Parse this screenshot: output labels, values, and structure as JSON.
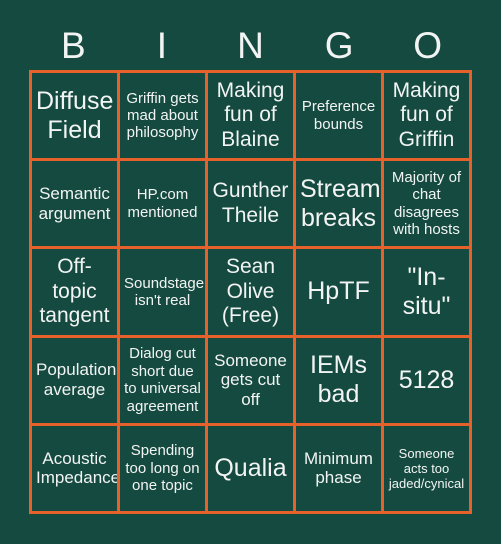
{
  "card": {
    "title": "BINGO",
    "header_letters": [
      "B",
      "I",
      "N",
      "G",
      "O"
    ],
    "colors": {
      "background": "#154a40",
      "border": "#e6622a",
      "text": "#f2f4f3"
    },
    "rows": [
      [
        {
          "text": "Diffuse Field",
          "size": "xl"
        },
        {
          "text": "Griffin gets mad about philosophy",
          "size": "sm"
        },
        {
          "text": "Making fun of Blaine",
          "size": "lg"
        },
        {
          "text": "Preference bounds",
          "size": "sm"
        },
        {
          "text": "Making fun of Griffin",
          "size": "lg"
        }
      ],
      [
        {
          "text": "Semantic argument",
          "size": "md"
        },
        {
          "text": "HP.com mentioned",
          "size": "sm"
        },
        {
          "text": "Gunther Theile",
          "size": "lg"
        },
        {
          "text": "Stream breaks",
          "size": "xl"
        },
        {
          "text": "Majority of chat disagrees with hosts",
          "size": "sm"
        }
      ],
      [
        {
          "text": "Off-topic tangent",
          "size": "lg"
        },
        {
          "text": "Soundstage isn't real",
          "size": "sm"
        },
        {
          "text": "Sean Olive (Free)",
          "size": "lg"
        },
        {
          "text": "HpTF",
          "size": "xl"
        },
        {
          "text": "\"In-situ\"",
          "size": "xl"
        }
      ],
      [
        {
          "text": "Population average",
          "size": "md"
        },
        {
          "text": "Dialog cut short due to universal agreement",
          "size": "sm"
        },
        {
          "text": "Someone gets cut off",
          "size": "md"
        },
        {
          "text": "IEMs bad",
          "size": "xl"
        },
        {
          "text": "5128",
          "size": "xl"
        }
      ],
      [
        {
          "text": "Acoustic Impedance",
          "size": "md"
        },
        {
          "text": "Spending too long on one topic",
          "size": "sm"
        },
        {
          "text": "Qualia",
          "size": "xl"
        },
        {
          "text": "Minimum phase",
          "size": "md"
        },
        {
          "text": "Someone acts too jaded/cynical",
          "size": "xs"
        }
      ]
    ]
  }
}
